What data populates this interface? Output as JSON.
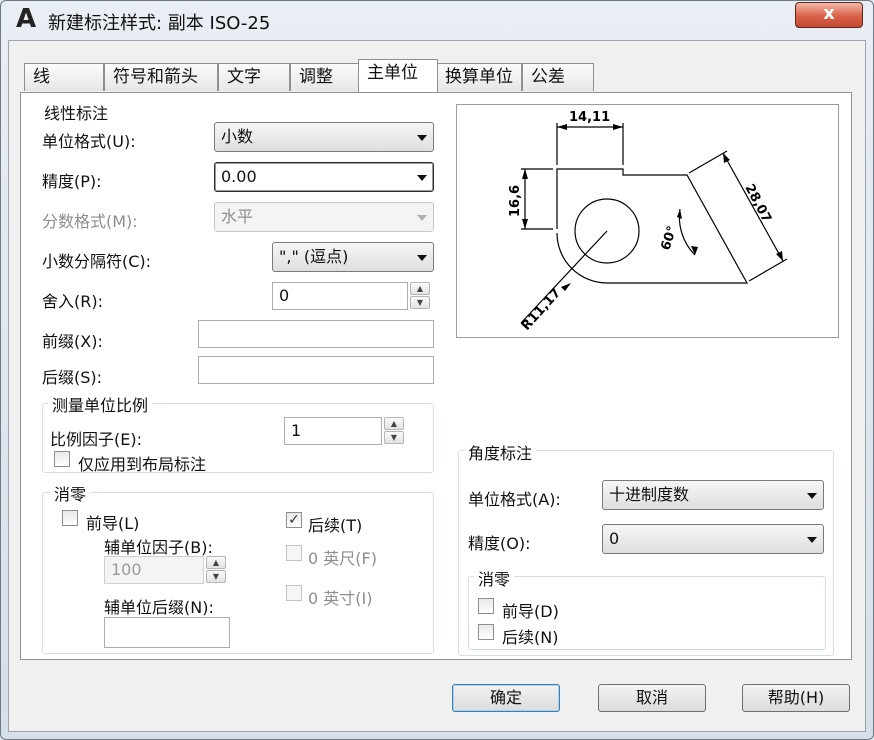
{
  "window": {
    "title": "新建标注样式: 副本 ISO-25",
    "close_label": "x"
  },
  "tabs": [
    "线",
    "符号和箭头",
    "文字",
    "调整",
    "主单位",
    "换算单位",
    "公差"
  ],
  "linear": {
    "group_label": "线性标注",
    "unit_format": {
      "label": "单位格式(U):",
      "value": "小数"
    },
    "precision": {
      "label": "精度(P):",
      "value": "0.00"
    },
    "fraction_format": {
      "label": "分数格式(M):",
      "value": "水平"
    },
    "decimal_separator": {
      "label": "小数分隔符(C):",
      "value": "\",\" (逗点)"
    },
    "round_off": {
      "label": "舍入(R):",
      "value": "0"
    },
    "prefix": {
      "label": "前缀(X):",
      "value": ""
    },
    "suffix": {
      "label": "后缀(S):",
      "value": ""
    }
  },
  "scale": {
    "group_label": "测量单位比例",
    "factor_label": "比例因子(E):",
    "factor_value": "1",
    "layout_only_label": "仅应用到布局标注"
  },
  "zero": {
    "group_label": "消零",
    "leading_label": "前导(L)",
    "sub_factor_label": "辅单位因子(B):",
    "sub_factor_value": "100",
    "sub_suffix_label": "辅单位后缀(N):",
    "sub_suffix_value": "",
    "trailing_label": "后续(T)",
    "feet_label": "0 英尺(F)",
    "inches_label": "0 英寸(I)"
  },
  "angular": {
    "group_label": "角度标注",
    "unit_format": {
      "label": "单位格式(A):",
      "value": "十进制度数"
    },
    "precision": {
      "label": "精度(O):",
      "value": "0"
    },
    "zero_group_label": "消零",
    "leading_label": "前导(D)",
    "trailing_label": "后续(N)"
  },
  "preview": {
    "dim_top": "14,11",
    "dim_left": "16,6",
    "dim_right": "28,07",
    "dim_angle": "60°",
    "dim_radius": "R11,17"
  },
  "buttons": {
    "ok": "确定",
    "cancel": "取消",
    "help": "帮助(H)"
  }
}
